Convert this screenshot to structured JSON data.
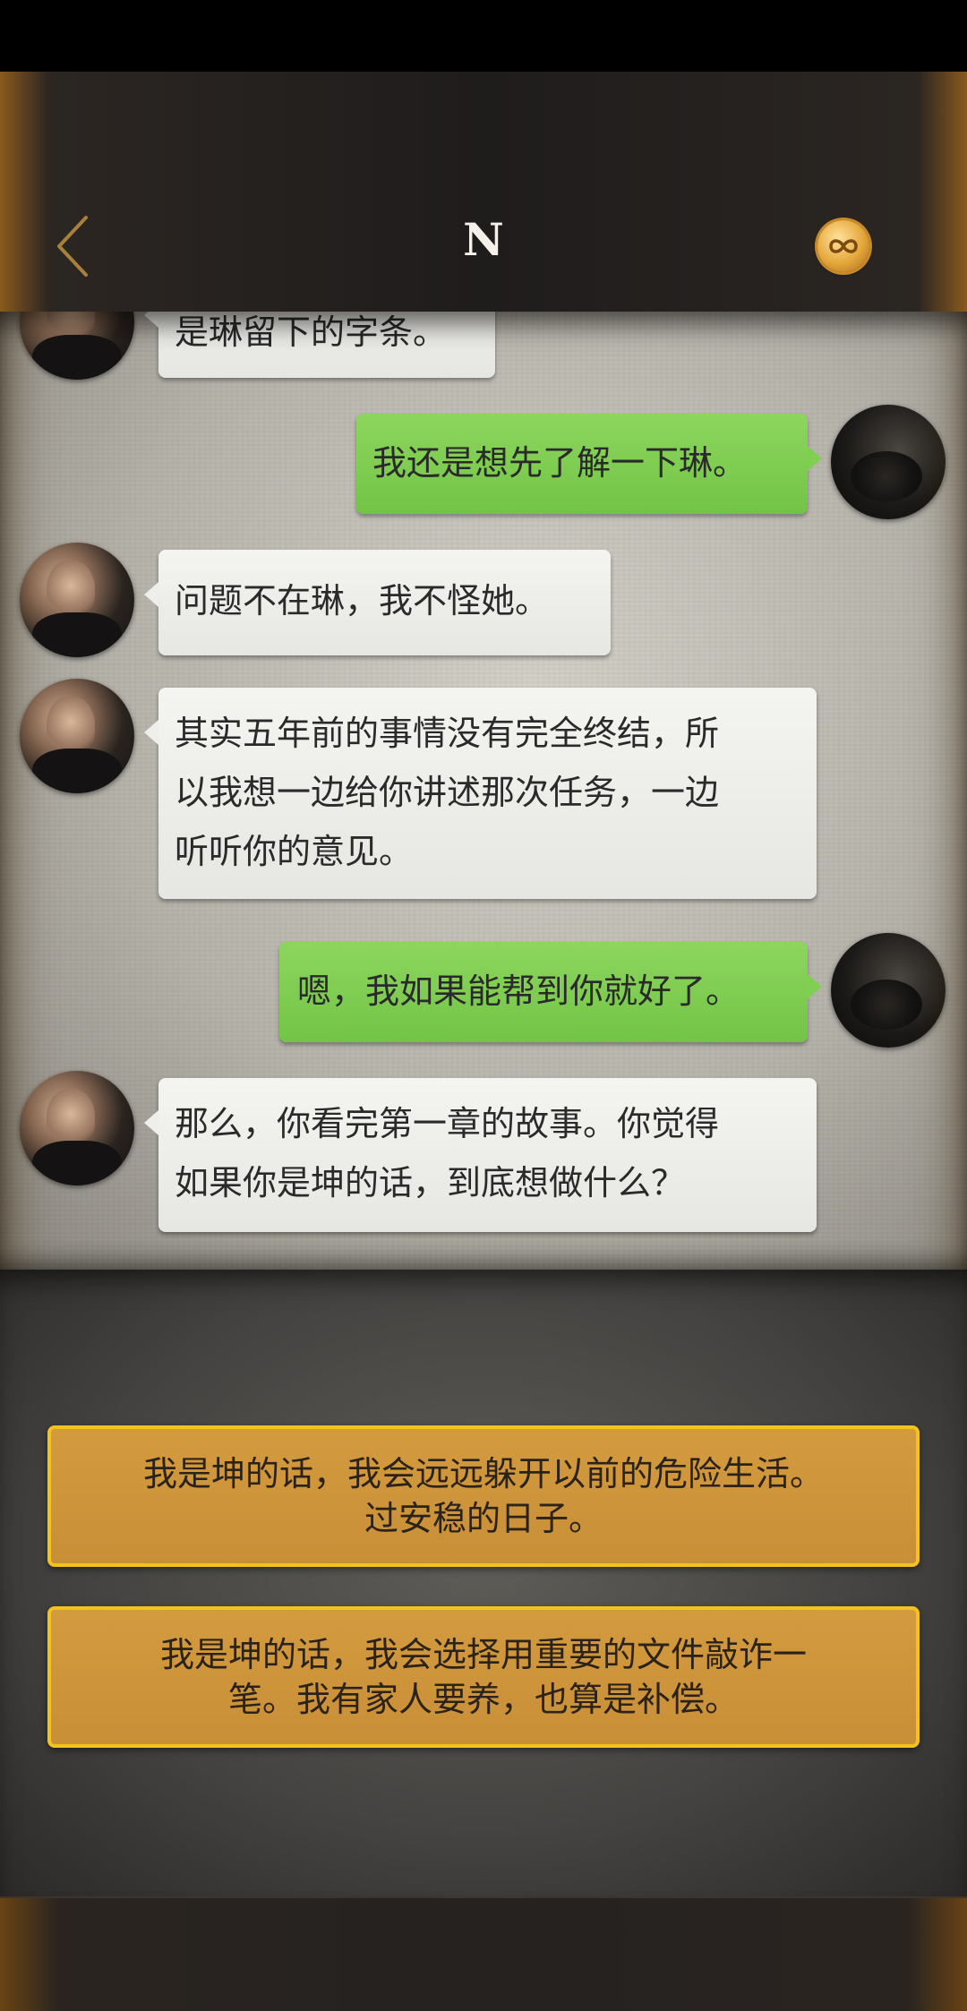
{
  "header": {
    "title": "N",
    "back_icon": "chevron-left-icon",
    "coin_icon": "infinity-coin-icon",
    "accent_color": "#a8803a"
  },
  "messages": [
    {
      "side": "npc",
      "text": "是琳留下的字条。"
    },
    {
      "side": "player",
      "text": "我还是想先了解一下琳。"
    },
    {
      "side": "npc",
      "text": "问题不在琳，我不怪她。"
    },
    {
      "side": "npc",
      "lines": [
        "其实五年前的事情没有完全终结，所",
        "以我想一边给你讲述那次任务，一边",
        "听听你的意见。"
      ]
    },
    {
      "side": "player",
      "text": "嗯，我如果能帮到你就好了。"
    },
    {
      "side": "npc",
      "lines": [
        "那么，你看完第一章的故事。你觉得",
        "如果你是坤的话，到底想做什么？"
      ]
    }
  ],
  "options": [
    {
      "lines": [
        "我是坤的话，我会远远躲开以前的危险生活。",
        "过安稳的日子。"
      ]
    },
    {
      "lines": [
        "我是坤的话，我会选择用重要的文件敲诈一",
        "笔。我有家人要养，也算是补偿。"
      ]
    }
  ],
  "colors": {
    "player_bubble": "#80cf52",
    "npc_bubble": "#eeeeea",
    "option_border": "#f3c21e",
    "option_fill": "#d49a3e"
  }
}
